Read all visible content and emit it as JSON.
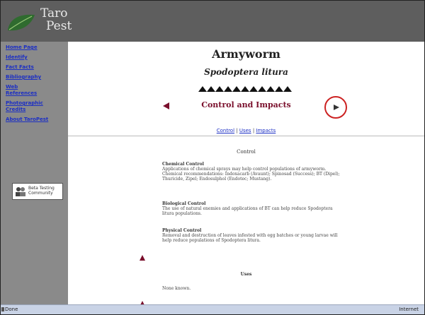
{
  "logo": {
    "line1": "Taro",
    "line2": "Pest"
  },
  "sidebar": {
    "items": [
      {
        "label": "Home Page"
      },
      {
        "label": "Identify"
      },
      {
        "label": "Fact Facts"
      },
      {
        "label": "Bibliography"
      },
      {
        "label": "Web References"
      },
      {
        "label": "Photographic Credits"
      },
      {
        "label": "About TaroPest"
      }
    ],
    "badge": {
      "line1": "Beta Testing",
      "line2": "Community"
    }
  },
  "main": {
    "title": "Armyworm",
    "subtitle": "Spodoptera litura",
    "section_heading": "Control and Impacts",
    "nav_links": [
      {
        "label": "Control"
      },
      {
        "label": "Uses"
      },
      {
        "label": "Impacts"
      }
    ],
    "nav_separator": " | ",
    "control_heading": "Control",
    "blocks": [
      {
        "heading": "Chemical Control",
        "text": "Applications of chemical sprays may help control populations of armyworm. Chemical recommendations: Indoxacarb (Avaunt); Spinosad (Success); BT (Dipel); Thuricide, Zipel; Endosulphol (Endotec; Mustang)."
      },
      {
        "heading": "Biological Control",
        "text": "The use of natural enemies and applications of BT can help reduce Spodoptera litura populations."
      },
      {
        "heading": "Physical Control",
        "text": "Removal and destruction of leaves infested with egg batches or young larvae will help reduce populations of Spodoptera litura."
      }
    ],
    "uses_heading": "Uses",
    "uses_text": "None known."
  },
  "statusbar": {
    "left": "Done",
    "right": "Internet"
  },
  "colors": {
    "topbar": "#5e5e5e",
    "sidebar": "#8a8a8a",
    "accent": "#7a0f2c",
    "link": "#1c2fc4",
    "highlight_ring": "#cc2222"
  }
}
